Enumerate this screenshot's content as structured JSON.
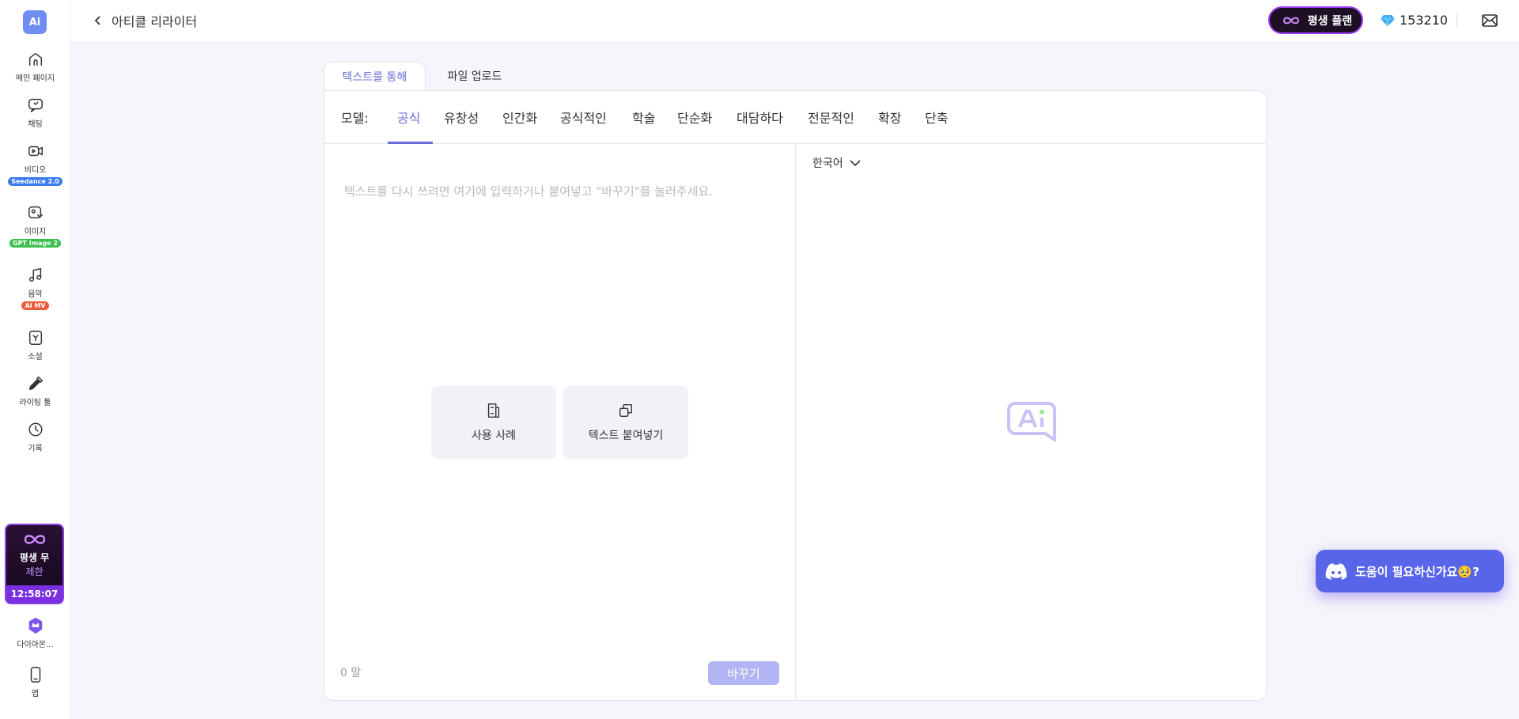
{
  "sidebar": {
    "logo_text": "Ai",
    "items": [
      {
        "label": "메인 페이지",
        "icon": "home-icon"
      },
      {
        "label": "채팅",
        "icon": "chat-icon"
      },
      {
        "label": "비디오",
        "icon": "video-icon",
        "badge": "Seedance 2.0",
        "badge_color": "#3b7cf2"
      },
      {
        "label": "이미지",
        "icon": "image-icon",
        "badge": "GPT Image 2",
        "badge_color": "#3cbf4f"
      },
      {
        "label": "음악",
        "icon": "music-icon",
        "badge": "AI MV",
        "badge_color": "#ef5a3b"
      },
      {
        "label": "소설",
        "icon": "novel-icon"
      },
      {
        "label": "라이팅 툴",
        "icon": "pen-icon"
      },
      {
        "label": "기록",
        "icon": "history-icon"
      }
    ],
    "promo": {
      "line1": "평생 무",
      "line2": "제한",
      "timer": "12:58:07"
    },
    "diamond": {
      "label": "다이아몬..."
    },
    "app": {
      "label": "앱"
    }
  },
  "header": {
    "back_label": "아티클 리라이터",
    "plan_label": "평생 플랜",
    "credits": "153210"
  },
  "tabs": [
    {
      "label": "텍스트를 통해",
      "active": true
    },
    {
      "label": "파일 업로드",
      "active": false
    }
  ],
  "model": {
    "label": "모델:",
    "options": [
      "공식",
      "유창성",
      "인간화",
      "공식적인",
      "학술",
      "단순화",
      "대담하다",
      "전문적인",
      "확장",
      "단축"
    ],
    "selected": "공식"
  },
  "editor": {
    "placeholder": "텍스트를 다시 쓰려면 여기에 입력하거나 붙여넣고 \"바꾸기\"를 눌러주세요.",
    "example_button": "사용 사례",
    "paste_button": "텍스트 붙여넣기",
    "word_count": "0 말",
    "submit_label": "바꾸기"
  },
  "output": {
    "language": "한국어"
  },
  "help": {
    "label": "도움이 필요하신가요🥺?"
  },
  "colors": {
    "accent": "#6b6fd8",
    "submit_disabled": "#b2b4f3",
    "plan_border": "#9b3df2",
    "avatar": "#e8731c",
    "discord": "#5865e8"
  }
}
